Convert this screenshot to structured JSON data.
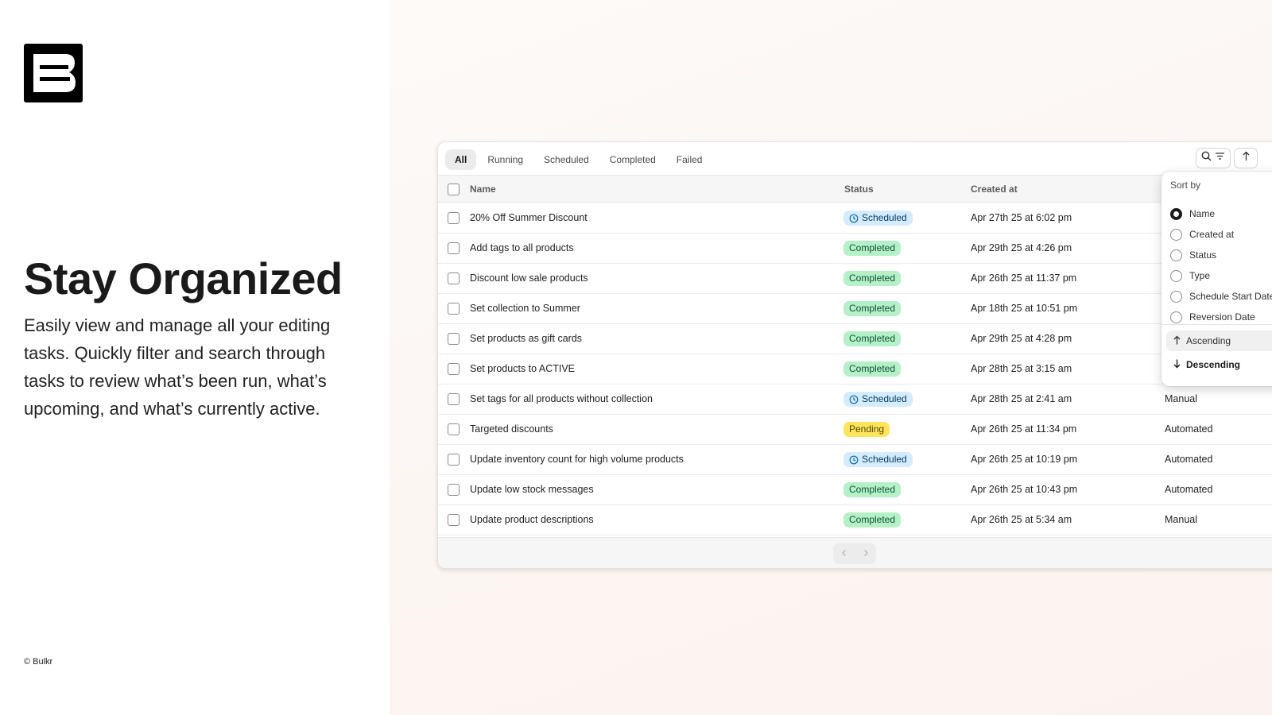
{
  "hero": {
    "title": "Stay Organized",
    "text": "Easily view and manage all your editing tasks. Quickly filter and search through tasks to review what’s been run, what’s upcoming, and what’s currently active.",
    "copyright": "© Bulkr"
  },
  "tabs": [
    {
      "label": "All",
      "active": true
    },
    {
      "label": "Running",
      "active": false
    },
    {
      "label": "Scheduled",
      "active": false
    },
    {
      "label": "Completed",
      "active": false
    },
    {
      "label": "Failed",
      "active": false
    }
  ],
  "icons": {
    "search": "search-icon",
    "filter": "filter-lines-icon",
    "sort": "sort-arrow-icon",
    "clock": "clock-icon",
    "prev": "chevron-left-icon",
    "next": "chevron-right-icon"
  },
  "table": {
    "columns": {
      "name": "Name",
      "status": "Status",
      "created": "Created at"
    },
    "rows": [
      {
        "name": "20% Off Summer Discount",
        "status": "Scheduled",
        "created": "Apr 27th 25 at 6:02 pm",
        "type": ""
      },
      {
        "name": "Add tags to all products",
        "status": "Completed",
        "created": "Apr 29th 25 at 4:26 pm",
        "type": ""
      },
      {
        "name": "Discount low sale products",
        "status": "Completed",
        "created": "Apr 26th 25 at 11:37 pm",
        "type": ""
      },
      {
        "name": "Set collection to Summer",
        "status": "Completed",
        "created": "Apr 18th 25 at 10:51 pm",
        "type": ""
      },
      {
        "name": "Set products as gift cards",
        "status": "Completed",
        "created": "Apr 29th 25 at 4:28 pm",
        "type": ""
      },
      {
        "name": "Set products to ACTIVE",
        "status": "Completed",
        "created": "Apr 28th 25 at 3:15 am",
        "type": ""
      },
      {
        "name": "Set tags for all products without collection",
        "status": "Scheduled",
        "created": "Apr 28th 25 at 2:41 am",
        "type": "Manual"
      },
      {
        "name": "Targeted discounts",
        "status": "Pending",
        "created": "Apr 26th 25 at 11:34 pm",
        "type": "Automated"
      },
      {
        "name": "Update inventory count for high volume products",
        "status": "Scheduled",
        "created": "Apr 26th 25 at 10:19 pm",
        "type": "Automated"
      },
      {
        "name": "Update low stock messages",
        "status": "Completed",
        "created": "Apr 26th 25 at 10:43 pm",
        "type": "Automated"
      },
      {
        "name": "Update product descriptions",
        "status": "Completed",
        "created": "Apr 26th 25 at 5:34 am",
        "type": "Manual"
      }
    ]
  },
  "sort": {
    "title": "Sort by",
    "options": [
      {
        "label": "Name",
        "selected": true
      },
      {
        "label": "Created at",
        "selected": false
      },
      {
        "label": "Status",
        "selected": false
      },
      {
        "label": "Type",
        "selected": false
      },
      {
        "label": "Schedule Start Date",
        "selected": false
      },
      {
        "label": "Reversion Date",
        "selected": false
      }
    ],
    "ascending": "Ascending",
    "descending": "Descending"
  },
  "colors": {
    "completed_bg": "#b5f0c8",
    "scheduled_bg": "#d5ebff",
    "pending_bg": "#ffe45c"
  }
}
